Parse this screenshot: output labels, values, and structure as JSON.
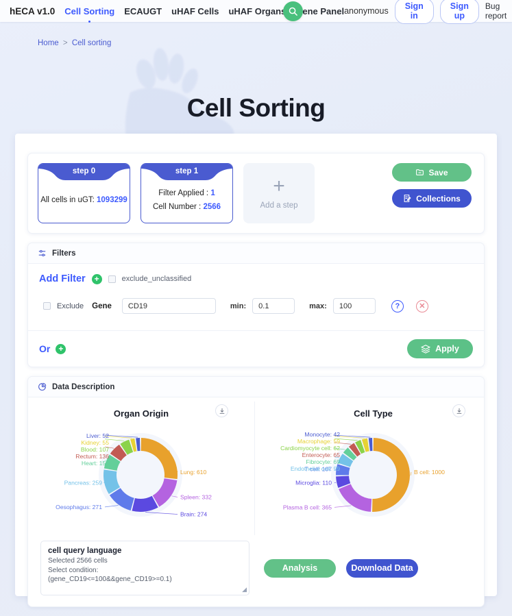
{
  "nav": {
    "brand": "hECA v1.0",
    "links": [
      {
        "label": "Cell Sorting",
        "active": true
      },
      {
        "label": "ECAUGT",
        "active": false
      },
      {
        "label": "uHAF Cells",
        "active": false
      },
      {
        "label": "uHAF Organs",
        "active": false
      },
      {
        "label": "Gene Panel",
        "active": false
      }
    ],
    "search_icon": "search-icon",
    "user": "anonymous",
    "sign_in": "Sign in",
    "sign_up": "Sign up",
    "bug_report": "Bug report"
  },
  "hero": {
    "breadcrumb_home": "Home",
    "breadcrumb_sep": ">",
    "breadcrumb_current": "Cell sorting",
    "title": "Cell Sorting"
  },
  "steps": {
    "items": [
      {
        "tab": "step 0",
        "lines": [
          {
            "label": "All cells in uGT:",
            "value": "1093299"
          }
        ]
      },
      {
        "tab": "step 1",
        "lines": [
          {
            "label": "Filter Applied :",
            "value": "1"
          },
          {
            "label": "Cell Number :",
            "value": "2566"
          }
        ]
      }
    ],
    "add_step_label": "Add a step",
    "add_step_glyph": "+",
    "save_label": "Save",
    "save_icon": "folder-minus-icon",
    "collections_label": "Collections",
    "collections_icon": "document-edit-icon"
  },
  "filters": {
    "header": "Filters",
    "header_icon": "sliders-icon",
    "add_filter_label": "Add Filter",
    "add_filter_icon": "plus-circle-icon",
    "exclude_unclassified_label": "exclude_unclassified",
    "exclude_unclassified_checked": false,
    "row": {
      "exclude_label": "Exclude",
      "exclude_checked": false,
      "type_label": "Gene",
      "gene_value": "CD19",
      "gene_placeholder": "Gene",
      "min_label": "min:",
      "min_value": "0.1",
      "max_label": "max:",
      "max_value": "100",
      "help_glyph": "?",
      "delete_glyph": "✕"
    },
    "or_label": "Or",
    "or_icon": "plus-circle-icon",
    "apply_label": "Apply",
    "apply_icon": "layers-icon"
  },
  "data_description": {
    "header": "Data Description",
    "header_icon": "pie-chart-icon",
    "download_icon": "download-icon"
  },
  "cql": {
    "title": "cell query language",
    "selected_line": "Selected 2566 cells",
    "condition_label": "Select condition:",
    "condition": "(gene_CD19<=100&&gene_CD19>=0.1)"
  },
  "bottom": {
    "analysis_label": "Analysis",
    "download_label": "Download Data"
  },
  "chart_data": [
    {
      "type": "pie",
      "title": "Organ Origin",
      "labels": [
        "Lung",
        "Spleen",
        "Brain",
        "Oesophagus",
        "Pancreas",
        "Heart",
        "Rectum",
        "Blood",
        "Kidney",
        "Liver"
      ],
      "values": [
        610,
        332,
        274,
        271,
        259,
        156,
        136,
        107,
        55,
        52
      ],
      "colors": [
        "#e8a12c",
        "#b463e0",
        "#5b49e0",
        "#5f7bea",
        "#74c2e8",
        "#63cf9a",
        "#c25b53",
        "#8bd34a",
        "#e6d234",
        "#4a5bd0"
      ],
      "donut": true,
      "legend": "labels-outside"
    },
    {
      "type": "pie",
      "title": "Cell Type",
      "labels": [
        "B cell",
        "Plasma B cell",
        "Microglia",
        "T cell",
        "Endothelial cell",
        "Fibrocyte",
        "Enterocyte",
        "Cardiomyocyte cell",
        "Macrophage",
        "Monocyte"
      ],
      "values": [
        1000,
        365,
        110,
        107,
        99,
        69,
        65,
        62,
        59,
        42
      ],
      "colors": [
        "#e8a12c",
        "#b463e0",
        "#5b49e0",
        "#5f7bea",
        "#74c2e8",
        "#63cf9a",
        "#c25b53",
        "#8bd34a",
        "#e6d234",
        "#4a5bd0"
      ],
      "donut": true,
      "legend": "labels-outside"
    }
  ]
}
